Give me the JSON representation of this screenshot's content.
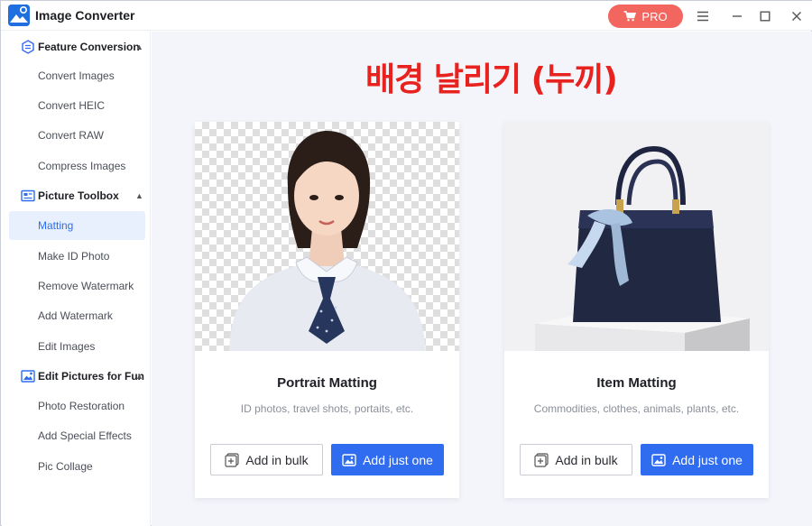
{
  "window": {
    "title": "Image Converter",
    "pro_label": "PRO"
  },
  "sidebar": {
    "sections": [
      {
        "label": "Feature Conversion",
        "items": [
          "Convert Images",
          "Convert HEIC",
          "Convert RAW",
          "Compress Images"
        ]
      },
      {
        "label": "Picture Toolbox",
        "items": [
          "Matting",
          "Make ID Photo",
          "Remove Watermark",
          "Add Watermark",
          "Edit Images"
        ]
      },
      {
        "label": "Edit Pictures for Fun",
        "items": [
          "Photo Restoration",
          "Add Special Effects",
          "Pic Collage"
        ]
      }
    ],
    "active_item": "Matting"
  },
  "overlay": {
    "title": "배경 날리기 (누끼)"
  },
  "cards": [
    {
      "title": "Portrait Matting",
      "subtitle": "ID photos, travel shots, portaits, etc.",
      "bulk_label": "Add in bulk",
      "one_label": "Add just one"
    },
    {
      "title": "Item Matting",
      "subtitle": "Commodities, clothes, animals, plants, etc.",
      "bulk_label": "Add in bulk",
      "one_label": "Add just one"
    }
  ],
  "colors": {
    "accent": "#2f6cf0",
    "pro": "#f2665f",
    "overlay_text": "#e8231f",
    "active_bg": "#e9f0fd"
  }
}
